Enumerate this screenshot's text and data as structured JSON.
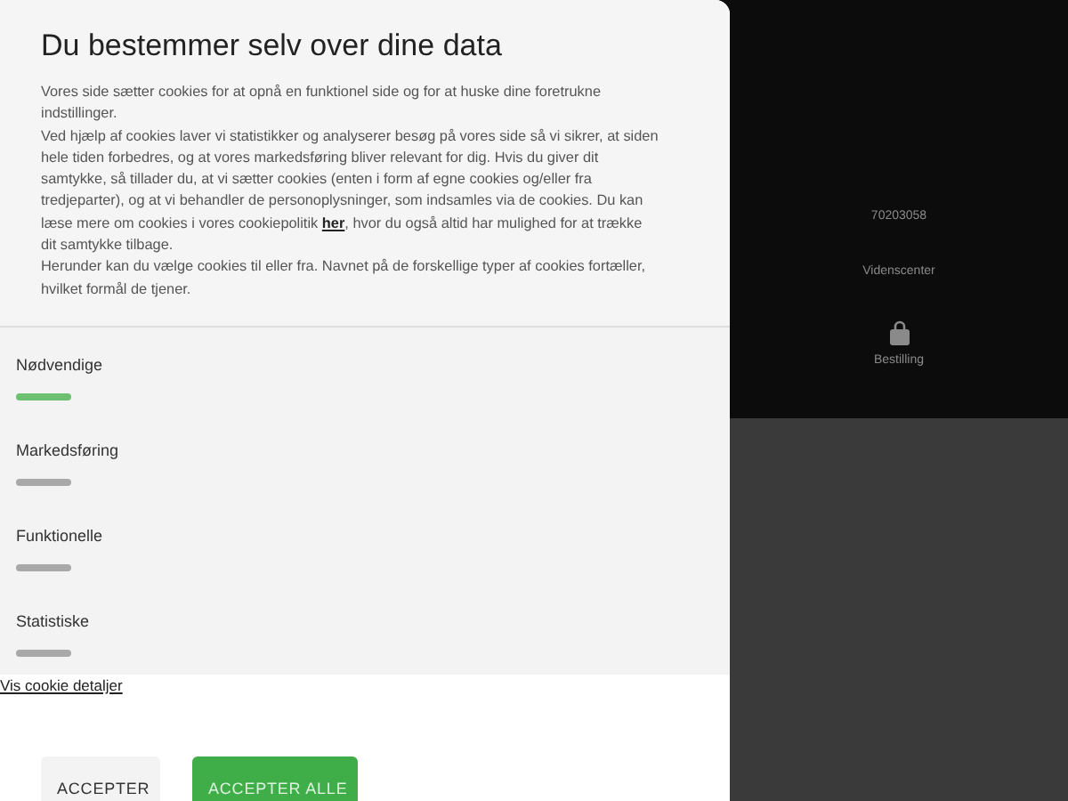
{
  "background": {
    "phone": "70203058",
    "knowledge_link": "Videnscenter",
    "order_link": "Bestilling"
  },
  "dialog": {
    "title": "Du bestemmer selv over dine data",
    "paragraphs": [
      "Vores side sætter cookies for at opnå en funktionel side og for at huske dine foretrukne indstillinger.",
      "Ved hjælp af cookies laver vi statistikker og analyserer besøg på vores side så vi sikrer, at siden hele tiden forbedres, og at vores markedsføring bliver relevant for dig. Hvis du giver dit samtykke, så tillader du, at vi sætter cookies (enten i form af egne cookies og/eller fra tredjeparter), og at vi behandler de personoplysninger, som indsamles via de cookies. Du kan læse mere om cookies i vores cookiepolitik **her**, hvor du også altid har mulighed for at trække dit samtykke tilbage.",
      "Herunder kan du vælge cookies til eller fra. Navnet på de forskellige typer af cookies fortæller, hvilket formål de tjener."
    ],
    "categories": [
      {
        "label": "Nødvendige",
        "on": true
      },
      {
        "label": "Markedsføring",
        "on": false
      },
      {
        "label": "Funktionelle",
        "on": false
      },
      {
        "label": "Statistiske",
        "on": false
      }
    ],
    "details_link": "Vis cookie detaljer",
    "buttons": [
      {
        "label": "ACCEPTER",
        "kind": "secondary"
      },
      {
        "label": "ACCEPTER ALLE",
        "kind": "primary"
      }
    ]
  }
}
